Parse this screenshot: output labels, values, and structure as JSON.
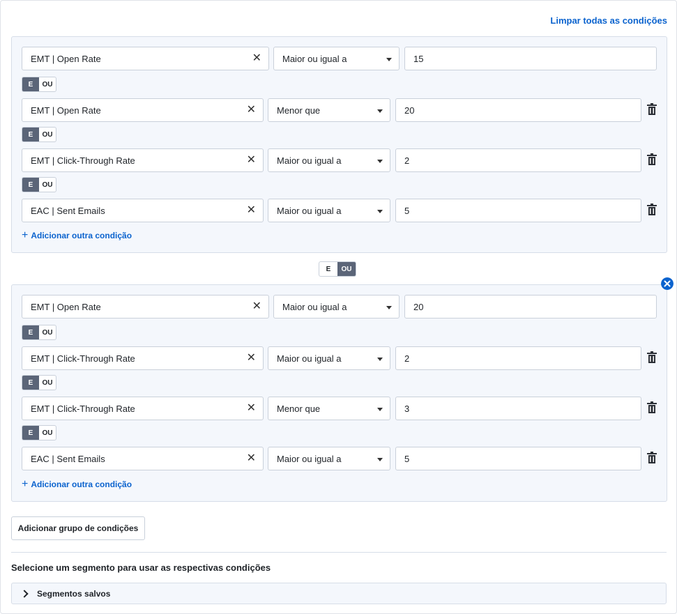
{
  "clear_all_label": "Limpar todas as condições",
  "and_label": "E",
  "or_label": "OU",
  "add_condition_label": "Adicionar outra condição",
  "groups": [
    {
      "conditions": [
        {
          "metric": "EMT | Open Rate",
          "operator": "Maior ou igual a",
          "value": "15"
        },
        {
          "metric": "EMT | Open Rate",
          "operator": "Menor que",
          "value": "20"
        },
        {
          "metric": "EMT | Click-Through Rate",
          "operator": "Maior ou igual a",
          "value": "2"
        },
        {
          "metric": "EAC | Sent Emails",
          "operator": "Maior ou igual a",
          "value": "5"
        }
      ]
    },
    {
      "conditions": [
        {
          "metric": "EMT | Open Rate",
          "operator": "Maior ou igual a",
          "value": "20"
        },
        {
          "metric": "EMT | Click-Through Rate",
          "operator": "Maior ou igual a",
          "value": "2"
        },
        {
          "metric": "EMT | Click-Through Rate",
          "operator": "Menor que",
          "value": "3"
        },
        {
          "metric": "EAC | Sent Emails",
          "operator": "Maior ou igual a",
          "value": "5"
        }
      ]
    }
  ],
  "between_groups_active": "OU",
  "within_group_active": "E",
  "add_group_label": "Adicionar grupo de condições",
  "segment_title": "Selecione um segmento para usar as respectivas condições",
  "saved_segments_label": "Segmentos salvos",
  "accent_color": "#0b63ce",
  "toggle_active_color": "#5b6578"
}
